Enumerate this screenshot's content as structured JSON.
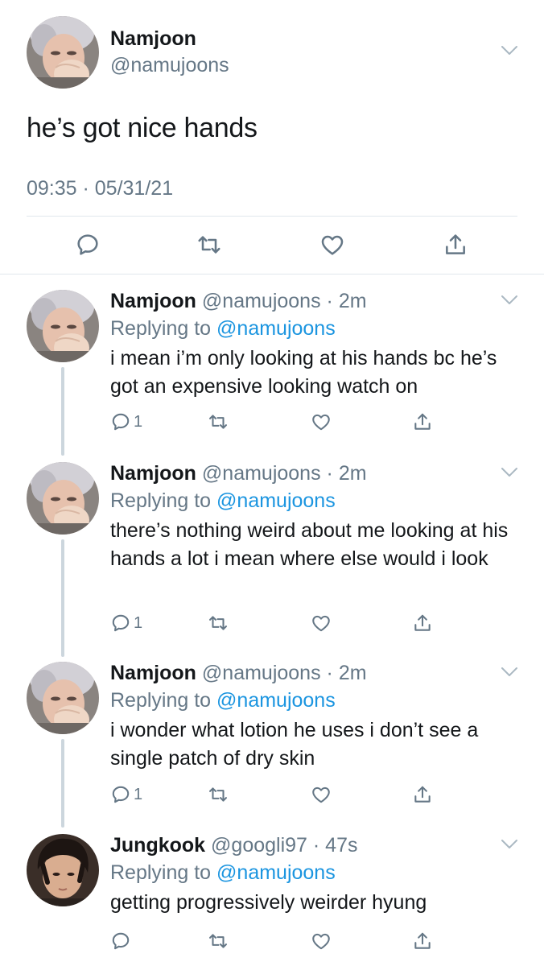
{
  "colors": {
    "text": "#14171a",
    "muted": "#657786",
    "link": "#1b95e0",
    "divider": "#e1e8ed",
    "thread_line": "#ccd6dd"
  },
  "main_tweet": {
    "name": "Namjoon",
    "handle": "@namujoons",
    "text": "he’s got nice hands",
    "timestamp": "09:35 · 05/31/21",
    "actions": [
      "reply-icon",
      "retweet-icon",
      "like-icon",
      "share-icon"
    ]
  },
  "replies": [
    {
      "name": "Namjoon",
      "handle": "@namujoons",
      "time": "2m",
      "replying_prefix": "Replying to ",
      "replying_to": "@namujoons",
      "text": "i mean i’m only looking at his hands bc he’s got an expensive looking watch on",
      "reply_count": "1",
      "avatar": "namjoon-avatar"
    },
    {
      "name": "Namjoon",
      "handle": "@namujoons",
      "time": "2m",
      "replying_prefix": "Replying to ",
      "replying_to": "@namujoons",
      "text": "there’s nothing weird about me looking at his hands a lot i mean where else would i look",
      "reply_count": "1",
      "avatar": "namjoon-avatar"
    },
    {
      "name": "Namjoon",
      "handle": "@namujoons",
      "time": "2m",
      "replying_prefix": "Replying to ",
      "replying_to": "@namujoons",
      "text": "i wonder what lotion he uses i don’t see a single patch of dry skin",
      "reply_count": "1",
      "avatar": "namjoon-avatar"
    },
    {
      "name": "Jungkook",
      "handle": "@googli97",
      "time": "47s",
      "replying_prefix": "Replying to ",
      "replying_to": "@namujoons",
      "text": "getting progressively weirder hyung",
      "reply_count": "",
      "avatar": "jungkook-avatar"
    }
  ]
}
